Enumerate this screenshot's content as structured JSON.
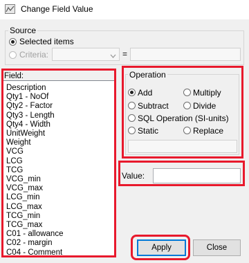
{
  "window": {
    "title": "Change Field Value",
    "icon": "app-icon"
  },
  "source": {
    "legend": "Source",
    "selected_label": "Selected items",
    "criteria_label": "Criteria:",
    "equals": "="
  },
  "field": {
    "label": "Field:",
    "items": [
      "Description",
      "Qty1 - NoOf",
      "Qty2 - Factor",
      "Qty3 - Length",
      "Qty4 - Width",
      "UnitWeight",
      "Weight",
      "VCG",
      "LCG",
      "TCG",
      "VCG_min",
      "VCG_max",
      "LCG_min",
      "LCG_max",
      "TCG_min",
      "TCG_max",
      "C01 - allowance",
      "C02 - margin",
      "C04 - Comment"
    ]
  },
  "operation": {
    "legend": "Operation",
    "add": "Add",
    "multiply": "Multiply",
    "subtract": "Subtract",
    "divide": "Divide",
    "sql": "SQL Operation (SI-units)",
    "static": "Static",
    "replace": "Replace",
    "selected": "Add"
  },
  "value": {
    "label": "Value:",
    "current": ""
  },
  "buttons": {
    "apply": "Apply",
    "close": "Close"
  },
  "colors": {
    "highlight": "#e8192c",
    "dialog_bg": "#f0f0f0"
  },
  "icons": {
    "dropdown": "chevron-down-icon"
  }
}
